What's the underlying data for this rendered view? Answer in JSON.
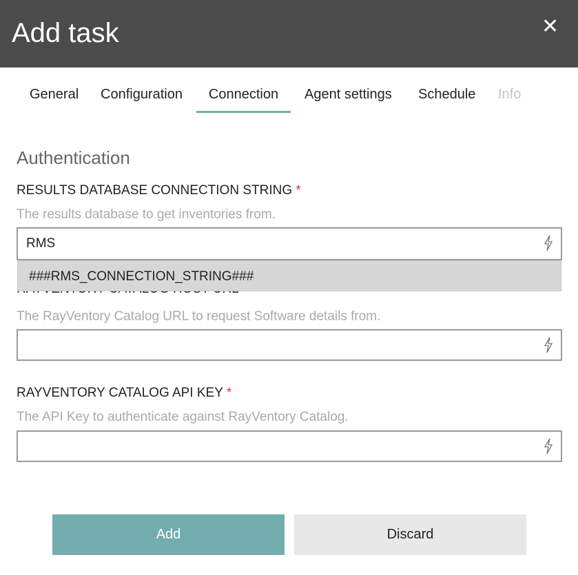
{
  "header": {
    "title": "Add task",
    "close_icon": "close-icon"
  },
  "tabs": [
    {
      "label": "General",
      "state": "normal"
    },
    {
      "label": "Configuration",
      "state": "normal"
    },
    {
      "label": "Connection",
      "state": "active"
    },
    {
      "label": "Agent settings",
      "state": "normal"
    },
    {
      "label": "Schedule",
      "state": "normal"
    },
    {
      "label": "Info",
      "state": "disabled"
    }
  ],
  "section_title": "Authentication",
  "fields": [
    {
      "label": "RESULTS DATABASE CONNECTION STRING",
      "required": "*",
      "help": "The results database to get inventories from.",
      "value": "RMS",
      "icon": "lightning-icon"
    },
    {
      "label": "RAYVENTORY CATALOG HOST URL",
      "help": "The RayVentory Catalog URL to request Software details from.",
      "value": "",
      "icon": "lightning-icon"
    },
    {
      "label": "RAYVENTORY CATALOG API KEY",
      "required": "*",
      "help": "The API Key to authenticate against RayVentory Catalog.",
      "value": "",
      "icon": "lightning-icon"
    }
  ],
  "autocomplete": {
    "options": [
      "###RMS_CONNECTION_STRING###"
    ]
  },
  "buttons": {
    "add": "Add",
    "discard": "Discard"
  },
  "colors": {
    "header": "#4b4b4b",
    "accent": "#74adad",
    "required": "#e0302a"
  }
}
